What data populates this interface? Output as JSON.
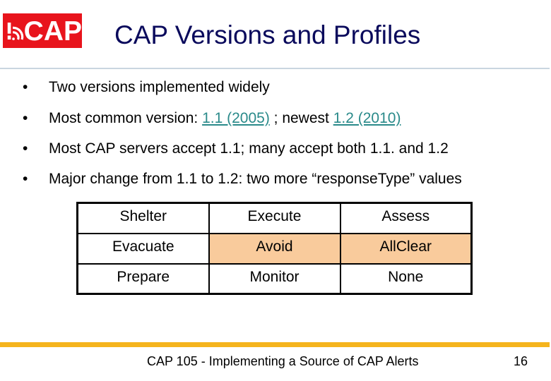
{
  "logo": {
    "text": "CAP",
    "icon": "alert-broadcast-icon",
    "color": "#e8141c"
  },
  "title": "CAP Versions and Profiles",
  "bullets": [
    {
      "marker": "•",
      "text": "Two versions implemented widely"
    },
    {
      "marker": "•",
      "prefix": "Most common version: ",
      "link1": "1.1 (2005)",
      "middle": " ; newest ",
      "link2": "1.2 (2010)"
    },
    {
      "marker": "•",
      "text": "Most CAP servers accept 1.1; many accept both 1.1. and 1.2"
    },
    {
      "marker": "•",
      "text": "Major change from 1.1 to 1.2: two more “responseType” values"
    }
  ],
  "response_table": {
    "rows": [
      [
        {
          "value": "Shelter",
          "new": false
        },
        {
          "value": "Execute",
          "new": false
        },
        {
          "value": "Assess",
          "new": false
        }
      ],
      [
        {
          "value": "Evacuate",
          "new": false
        },
        {
          "value": "Avoid",
          "new": true
        },
        {
          "value": "AllClear",
          "new": true
        }
      ],
      [
        {
          "value": "Prepare",
          "new": false
        },
        {
          "value": "Monitor",
          "new": false
        },
        {
          "value": "None",
          "new": false
        }
      ]
    ],
    "highlight_color": "#f9cb9c"
  },
  "footer": {
    "text": "CAP 105 - Implementing a Source of CAP Alerts",
    "page_number": "16",
    "bar_color": "#f5b41d"
  },
  "colors": {
    "title": "#0a0a5c",
    "link": "#2a8a8a",
    "rule": "#c9d6e0"
  }
}
